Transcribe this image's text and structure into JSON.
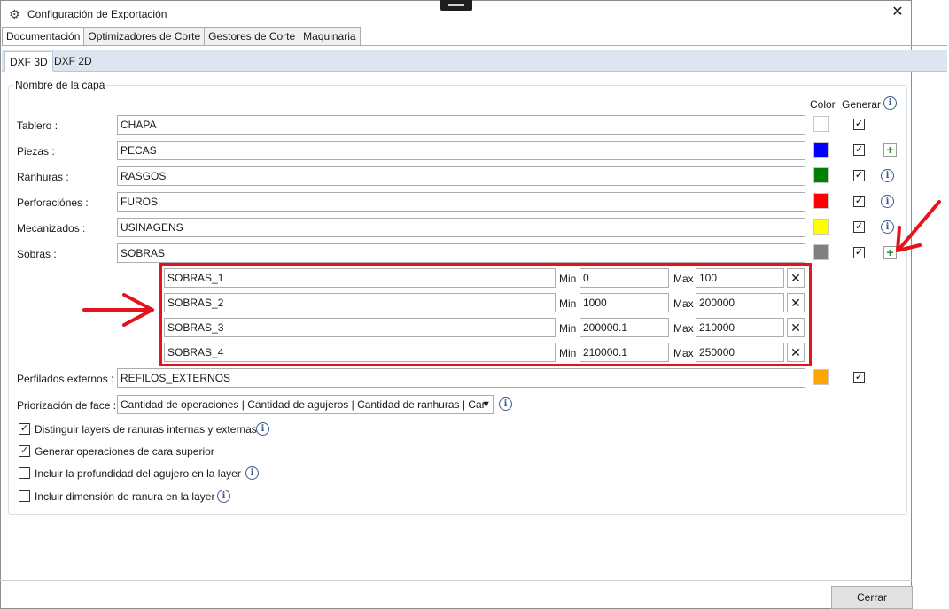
{
  "window": {
    "title": "Configuración de Exportación",
    "close_glyph": "✕"
  },
  "tabs": [
    "Documentación",
    "Optimizadores de Corte",
    "Gestores de Corte",
    "Maquinaria"
  ],
  "subtabs": [
    "DXF 3D",
    "DXF 2D"
  ],
  "group": {
    "legend": "Nombre de la capa",
    "color_header": "Color",
    "generar_header": "Generar"
  },
  "layers": [
    {
      "label": "Tablero :",
      "value": "CHAPA",
      "color": "#ffffff"
    },
    {
      "label": "Piezas :",
      "value": "PECAS",
      "color": "#0000ff"
    },
    {
      "label": "Ranhuras :",
      "value": "RASGOS",
      "color": "#008000"
    },
    {
      "label": "Perforaciónes :",
      "value": "FUROS",
      "color": "#ff0000"
    },
    {
      "label": "Mecanizados :",
      "value": "USINAGENS",
      "color": "#ffff00"
    },
    {
      "label": "Sobras :",
      "value": "SOBRAS",
      "color": "#808080"
    }
  ],
  "sobras": {
    "min_label": "Min",
    "max_label": "Max",
    "remove_glyph": "✕",
    "rows": [
      {
        "name": "SOBRAS_1",
        "min": "0",
        "max": "100"
      },
      {
        "name": "SOBRAS_2",
        "min": "1000",
        "max": "200000"
      },
      {
        "name": "SOBRAS_3",
        "min": "200000.1",
        "max": "210000"
      },
      {
        "name": "SOBRAS_4",
        "min": "210000.1",
        "max": "250000"
      }
    ]
  },
  "perfilados": {
    "label": "Perfilados externos :",
    "value": "REFILOS_EXTERNOS",
    "color": "#ffa500"
  },
  "priorizacion": {
    "label": "Priorización de face :",
    "value": "Cantidad de operaciones | Cantidad de agujeros | Cantidad de ranhuras | Car"
  },
  "options": [
    {
      "label": "Distinguir layers de ranuras internas y externas",
      "checked": true
    },
    {
      "label": "Generar operaciones de cara superior",
      "checked": true
    },
    {
      "label": "Incluir la profundidad del agujero en la layer",
      "checked": false
    },
    {
      "label": "Incluir dimensión de ranura en la layer",
      "checked": false
    }
  ],
  "buttons": {
    "close": "Cerrar"
  },
  "glyphs": {
    "check": "✓",
    "info": "i",
    "plus": "+",
    "dropdown": "▼",
    "gear": "⚙"
  },
  "colors": {
    "annotation": "#e4131c",
    "subtab_bar": "#dbe6f1"
  }
}
